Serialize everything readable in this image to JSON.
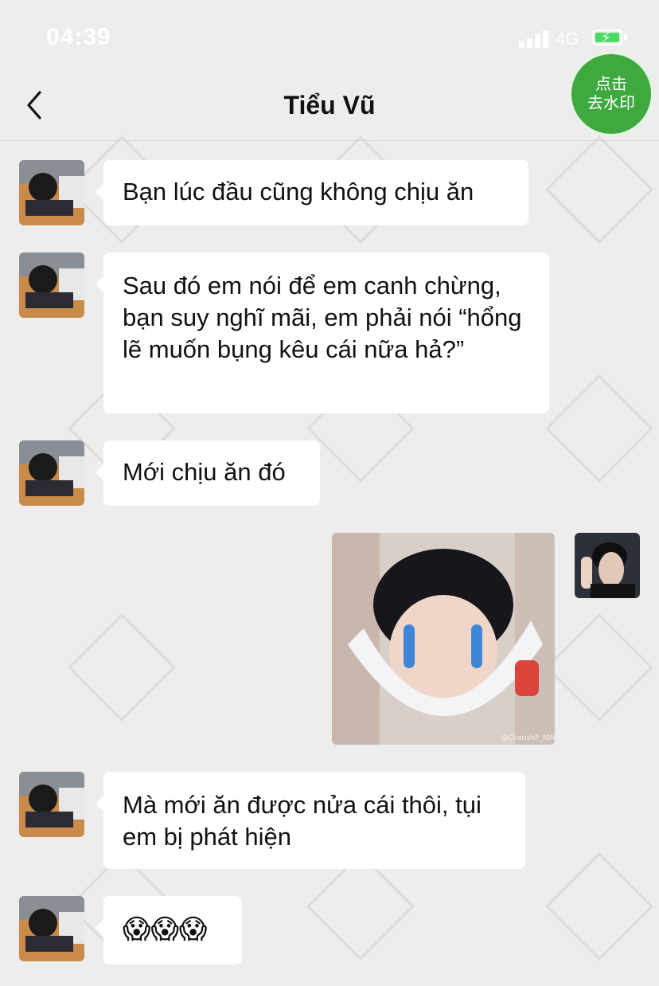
{
  "status_bar": {
    "time": "04:39",
    "network": "4G"
  },
  "nav": {
    "title": "Tiểu Vũ"
  },
  "watermark_button": {
    "line1": "点击",
    "line2": "去水印"
  },
  "messages": [
    {
      "side": "left",
      "text": "Bạn lúc đầu cũng không chịu ăn"
    },
    {
      "side": "left",
      "text": "Sau đó em nói để em canh chừng, bạn suy nghĩ mãi, em phải nói “hổng lẽ muốn bụng kêu cái nữa hả?”"
    },
    {
      "side": "left",
      "text": "Mới chịu ăn đó"
    },
    {
      "side": "right",
      "type": "image",
      "image_caption": "@CherishP_NINE"
    },
    {
      "side": "left",
      "text": "Mà mới ăn được nửa cái thôi, tụi em bị phát hiện"
    },
    {
      "side": "left",
      "text": "😱😱😱"
    }
  ]
}
